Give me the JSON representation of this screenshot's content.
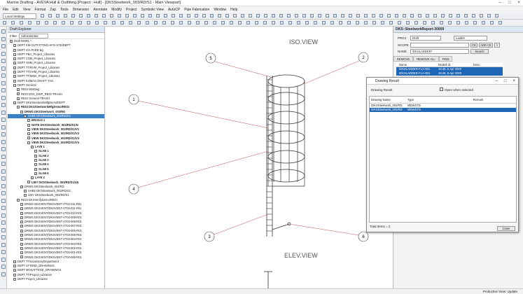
{
  "window": {
    "title": "Marine Drafting - AVEVA Hull & Outfitting [Project : Hull] - [DKSSteelwork_003/RD/S1 - Main Viewport]"
  },
  "menu": [
    "File",
    "Edit",
    "View",
    "Format",
    "Zap",
    "Tools",
    "Dimension",
    "Annotate",
    "Modify",
    "Project",
    "Symbolic View",
    "AutoCP",
    "Pipe Fabrication",
    "Window",
    "Help"
  ],
  "toolbar": {
    "local_settings": "Local Settings"
  },
  "explorer": {
    "title": "Draft Explorer",
    "filter_label": "Filter",
    "filter_value": "Administrator",
    "rows": [
      {
        "text": "Draft WORL *",
        "indent": 0,
        "cls": ""
      },
      {
        "text": "DEPT KM-OUTFITTING-HFG-STD/DEPT",
        "indent": 1,
        "cls": ""
      },
      {
        "text": "DEPT ISA PADD Eg",
        "indent": 1,
        "cls": ""
      },
      {
        "text": "DEPT PBA_Project_Libraries",
        "indent": 1,
        "cls": ""
      },
      {
        "text": "DEPT CSM_Project_Libraries",
        "indent": 1,
        "cls": ""
      },
      {
        "text": "DEPT HSM_Project_Libraries",
        "indent": 1,
        "cls": ""
      },
      {
        "text": "DEPT TT/RVM_Project_Libraries",
        "indent": 1,
        "cls": ""
      },
      {
        "text": "DEPT TT/AHM_Project_Libraries",
        "indent": 1,
        "cls": ""
      },
      {
        "text": "DEPT TT/MNH_Project_Libraries",
        "indent": 1,
        "cls": ""
      },
      {
        "text": "DEPT KOMAG DRAFT TAG",
        "indent": 1,
        "cls": ""
      },
      {
        "text": "DEPT General",
        "indent": 1,
        "cls": ""
      },
      {
        "text": "REGI MarDwg",
        "indent": 2,
        "cls": ""
      },
      {
        "text": "REGI DSS_DISP_REGI-TRASH",
        "indent": 2,
        "cls": ""
      },
      {
        "text": "REGI General-TRASH",
        "indent": 2,
        "cls": ""
      },
      {
        "text": "DEPT DKSSteelworkMfgDemo/DEPT",
        "indent": 1,
        "cls": ""
      },
      {
        "text": "REGI DKSSteelworkMfgDemo/REGI",
        "indent": 2,
        "cls": "bold"
      },
      {
        "text": "DRWG DKSSteelwork_003/RD",
        "indent": 3,
        "cls": "bold"
      },
      {
        "text": "SHEE DKSSteelwork_003/RD/S1",
        "indent": 4,
        "cls": "sel"
      },
      {
        "text": "IMGSLD 1",
        "indent": 5,
        "cls": "bold"
      },
      {
        "text": "NOTE DKSSteelwork_003/RD/S1/N",
        "indent": 5,
        "cls": "bold"
      },
      {
        "text": "VIEW DKSSteelwork_003/RD/S1/V1",
        "indent": 5,
        "cls": "bold"
      },
      {
        "text": "VIEW DKSSteelwork_003/RD/S1/V2",
        "indent": 5,
        "cls": "bold"
      },
      {
        "text": "VIEW DKSSteelwork_003/RD/S1/V3",
        "indent": 5,
        "cls": "bold"
      },
      {
        "text": "VIEW DKSSteelwork_003/RD/S1/V4",
        "indent": 5,
        "cls": "bold"
      },
      {
        "text": "LAYE 1",
        "indent": 6,
        "cls": "bold"
      },
      {
        "text": "SLAB 1",
        "indent": 7,
        "cls": "bold"
      },
      {
        "text": "SLAB 2",
        "indent": 7,
        "cls": "bold"
      },
      {
        "text": "SLAB 3",
        "indent": 7,
        "cls": "bold"
      },
      {
        "text": "SLAB 4",
        "indent": 7,
        "cls": "bold"
      },
      {
        "text": "SLAB 5",
        "indent": 7,
        "cls": "bold"
      },
      {
        "text": "SLAB 6",
        "indent": 7,
        "cls": "bold"
      },
      {
        "text": "LAYE 2",
        "indent": 6,
        "cls": "bold"
      },
      {
        "text": "LIBY DKSSteelwork_003/RD/S1/LB",
        "indent": 5,
        "cls": "bold"
      },
      {
        "text": "DRWG DKSSteelwork_003/RD",
        "indent": 3,
        "cls": ""
      },
      {
        "text": "SHEE DKSSteelwork_003/RD/S1",
        "indent": 4,
        "cls": ""
      },
      {
        "text": "LIBY DKSSteelwork_003/RD/S1",
        "indent": 4,
        "cls": ""
      },
      {
        "text": "REGI DKSVerifyDemo/REGI",
        "indent": 2,
        "cls": ""
      },
      {
        "text": "DRWG DKSVENT/DKSVENT-VT03-011-R01",
        "indent": 3,
        "cls": ""
      },
      {
        "text": "DRWG DKSVENT/DKSVENT-VT03-011-R01",
        "indent": 3,
        "cls": ""
      },
      {
        "text": "DRWG DKSVENT/DKSVENT-VT03-010-R01",
        "indent": 3,
        "cls": ""
      },
      {
        "text": "DRWG DKSVENT/DKSVENT-VT03-009-R01",
        "indent": 3,
        "cls": ""
      },
      {
        "text": "DRWG DKSVENT/DKSVENT-VT03-008-R01",
        "indent": 3,
        "cls": ""
      },
      {
        "text": "DRWG DKSVENT/DKSVENT-VT03-007-R01",
        "indent": 3,
        "cls": ""
      },
      {
        "text": "DRWG DKSVENT/DKSVENT-VT03-006-R01",
        "indent": 3,
        "cls": ""
      },
      {
        "text": "DRWG DKSVENT/DKSVENT-VT03-005-R01",
        "indent": 3,
        "cls": ""
      },
      {
        "text": "DRWG DKSVENT/DKSVENT-VT03-004-R01",
        "indent": 3,
        "cls": ""
      },
      {
        "text": "DRWG DKSVENT/DKSVENT-VT03-003-R01",
        "indent": 3,
        "cls": ""
      },
      {
        "text": "DRWG DKSVENT/DKSVENT-VT03-002-R01",
        "indent": 3,
        "cls": ""
      },
      {
        "text": "DRWG DKSVENT/DKSVENT-VT03-001-R01",
        "indent": 3,
        "cls": ""
      },
      {
        "text": "DRWG DKSVENT/DKSVENT-VT03-000-R01",
        "indent": 3,
        "cls": ""
      },
      {
        "text": "DEPT TT/Ivorentory/Department",
        "indent": 1,
        "cls": ""
      },
      {
        "text": "DEPT AFTEND_DRAWINGS",
        "indent": 1,
        "cls": ""
      },
      {
        "text": "DEPT MOSAFTEND_DRAWINGS",
        "indent": 1,
        "cls": ""
      },
      {
        "text": "DEPT TT/Project_Libraries",
        "indent": 1,
        "cls": ""
      },
      {
        "text": "DEPT Project_Libraries",
        "indent": 1,
        "cls": ""
      }
    ]
  },
  "drawing": {
    "iso_view": "ISO.VIEW",
    "elev_view": "ELEV.VIEW",
    "balloons": [
      "5",
      "2",
      "1",
      "4",
      "3",
      "6"
    ]
  },
  "dks": {
    "title": "DKS::SteelworkReport-30009",
    "proj_label": "PROJ",
    "proj_value": "Draft",
    "proj_type": "Ladder",
    "scope_label": "SCOPE",
    "scope_btn1": "CE",
    "scope_btn2": "ADD CE",
    "name_label": "NAME",
    "name_value": "/DKSLADDER*",
    "search": "Search",
    "tabs": [
      "REMOVE",
      "REMOVE ALL",
      "FIND"
    ],
    "columns": [
      "Name",
      "Modell dt.",
      "Desc"
    ],
    "rows": [
      [
        "/DKSLADDER-FLA-001",
        "15:46, 5 Apr 2020",
        ""
      ],
      [
        "/DKSLADDER-FLA-001",
        "15:46, 5 Apr 2020",
        ""
      ]
    ]
  },
  "dialog": {
    "title": "Drawing Result",
    "label": "Drawing Result",
    "checkbox_label": "Open when selected",
    "columns": [
      "Drawing Name",
      "Type",
      "Remark"
    ],
    "rows": [
      [
        "/DKSSteelwork_003/RD",
        "MDWSTD",
        ""
      ],
      [
        "/DKSSteelwork_003/RD",
        "MDWSTD",
        ""
      ]
    ],
    "total": "Total Items = 2",
    "close": "Close"
  },
  "status": {
    "right": "Productive View: Update"
  }
}
